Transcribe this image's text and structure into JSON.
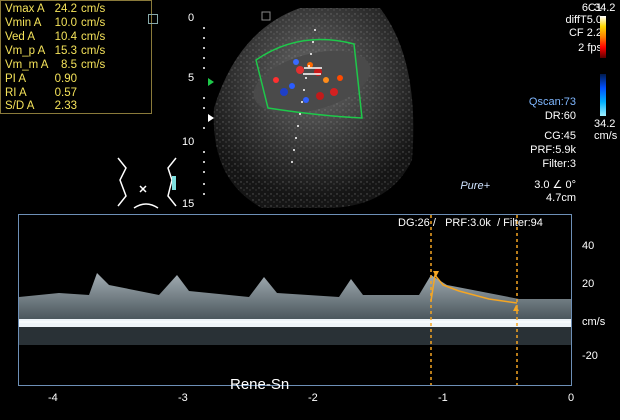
{
  "measurements": [
    {
      "label": "Vmax  A",
      "value": "24.2",
      "unit": "cm/s"
    },
    {
      "label": "Vmin  A",
      "value": "10.0",
      "unit": "cm/s"
    },
    {
      "label": "Ved  A",
      "value": "10.4",
      "unit": "cm/s"
    },
    {
      "label": "Vm_p  A",
      "value": "15.3",
      "unit": "cm/s"
    },
    {
      "label": "Vm_m  A",
      "value": "8.5",
      "unit": "cm/s"
    },
    {
      "label": "PI  A",
      "value": "0.90",
      "unit": ""
    },
    {
      "label": "RI  A",
      "value": "0.57",
      "unit": ""
    },
    {
      "label": "S/D  A",
      "value": "2.33",
      "unit": ""
    }
  ],
  "depth_scale": [
    "0",
    "5",
    "10",
    "15"
  ],
  "settings": {
    "probe": "6C1",
    "mode": "diffT5.0",
    "cf": "CF 2.2",
    "fps": "2 fps",
    "qscan": "Qscan:73",
    "dr": "DR:60",
    "cg": "CG:45",
    "prf": "PRF:5.9k",
    "filter": "Filter:3",
    "angle": "3.0  ∠ 0°",
    "depth": "4.7cm"
  },
  "color_scale": {
    "top": "34.2",
    "bottom": "34.2",
    "unit": "cm/s",
    "top_gradient": [
      "#ffffff",
      "#ffd700",
      "#ff7f00",
      "#ff0000",
      "#5a0000"
    ],
    "bottom_gradient": [
      "#001a4d",
      "#0050ff",
      "#00b0ff",
      "#a0f0ff"
    ]
  },
  "brand": "Pure+",
  "doppler_info": {
    "dg": "DG:26 /",
    "prf": "PRF:3.0k",
    "filter": "/ Filter:94"
  },
  "velocity_axis": {
    "ticks": [
      "40",
      "20",
      "cm/s",
      "-20"
    ]
  },
  "time_axis": {
    "ticks": [
      "-4",
      "-3",
      "-2",
      "-1",
      "0"
    ]
  },
  "annotation": "Rene-Sn",
  "colors": {
    "measurement_text": "#f5e35a",
    "frame": "#6d8fb6",
    "roi": "#1ec84a",
    "caliper": "#f5a623"
  }
}
